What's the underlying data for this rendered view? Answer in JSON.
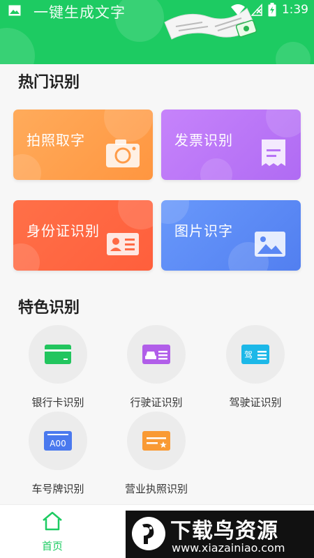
{
  "status_bar": {
    "app_title": "一键生成文字",
    "time": "1:39"
  },
  "hot_section": {
    "title": "热门识别",
    "cards": [
      {
        "label": "拍照取字",
        "color_from": "#ffab5b",
        "color_to": "#ff9640",
        "icon": "camera-icon"
      },
      {
        "label": "发票识别",
        "color_from": "#c683fb",
        "color_to": "#b06bf3",
        "icon": "receipt-icon"
      },
      {
        "label": "身份证识别",
        "color_from": "#ff7048",
        "color_to": "#ff5f3c",
        "icon": "id-card-icon"
      },
      {
        "label": "图片识字",
        "color_from": "#6898fb",
        "color_to": "#527ff0",
        "icon": "image-icon"
      }
    ]
  },
  "feature_section": {
    "title": "特色识别",
    "items": [
      {
        "label": "银行卡识别",
        "icon": "bank-card-icon",
        "color": "#22c55e"
      },
      {
        "label": "行驶证识别",
        "icon": "vehicle-license-icon",
        "color": "#b15ee9"
      },
      {
        "label": "驾驶证识别",
        "icon": "driver-license-icon",
        "color": "#1cb8e8"
      },
      {
        "label": "车号牌识别",
        "icon": "license-plate-icon",
        "color": "#4a79ee",
        "plate_text": "A00"
      },
      {
        "label": "营业执照识别",
        "icon": "business-license-icon",
        "color": "#f99a34"
      }
    ]
  },
  "driver_badge": "驾",
  "bottom_nav": {
    "home_label": "首页"
  },
  "watermark": {
    "title": "下载鸟资源",
    "url": "www.xiazainiao.com"
  },
  "colors": {
    "brand_green": "#1dcb62"
  }
}
